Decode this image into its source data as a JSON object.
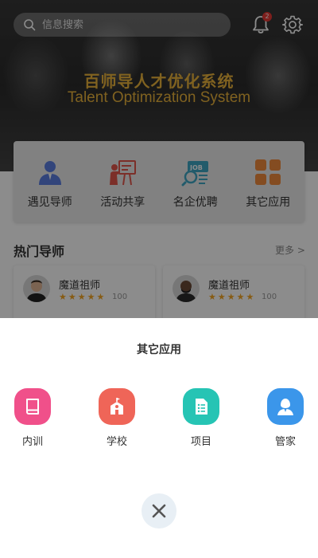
{
  "header": {
    "search_placeholder": "信息搜索",
    "notification_count": "2",
    "title_cn": "百师导人才优化系统",
    "title_en": "Talent Optimization System"
  },
  "quick_menu": [
    {
      "label": "遇见导师",
      "icon": "mentor-icon"
    },
    {
      "label": "活动共享",
      "icon": "activity-icon"
    },
    {
      "label": "名企优聘",
      "icon": "job-icon"
    },
    {
      "label": "其它应用",
      "icon": "apps-icon"
    }
  ],
  "hot_mentors": {
    "title": "热门导师",
    "more": "更多 >",
    "items": [
      {
        "name": "魔道祖师",
        "rating": 5,
        "score": "100"
      },
      {
        "name": "魔道祖师",
        "rating": 5,
        "score": "100"
      }
    ]
  },
  "sheet": {
    "title": "其它应用",
    "apps": [
      {
        "label": "内训",
        "icon": "book-icon",
        "color": "#f0508a"
      },
      {
        "label": "学校",
        "icon": "school-icon",
        "color": "#ef6558"
      },
      {
        "label": "项目",
        "icon": "document-icon",
        "color": "#26c4b4"
      },
      {
        "label": "管家",
        "icon": "butler-icon",
        "color": "#3b96ea"
      }
    ]
  },
  "colors": {
    "accent_gold": "#e9b23b",
    "star": "#f5a623"
  }
}
